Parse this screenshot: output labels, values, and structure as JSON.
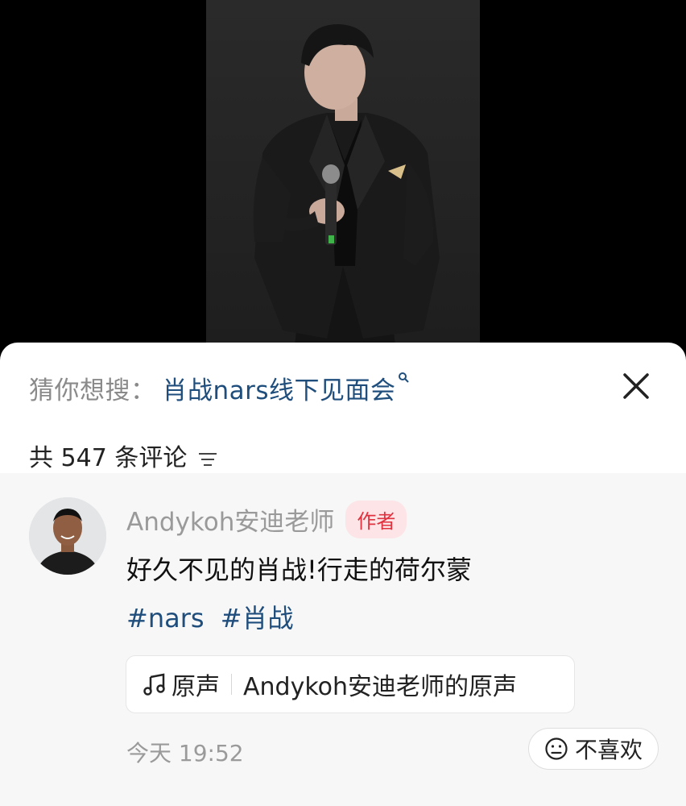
{
  "suggest": {
    "prefix": "猜你想搜：",
    "term": "肖战nars线下见面会",
    "search_icon": "search-icon"
  },
  "close": {
    "icon": "close-icon"
  },
  "comments_header": {
    "count_text": "共 547 条评论",
    "sort_icon": "sort-icon"
  },
  "comment": {
    "author": "Andykoh安迪老师",
    "badge": "作者",
    "text": "好久不见的肖战!行走的荷尔蒙",
    "hashtags": [
      "#nars",
      "#肖战"
    ],
    "sound": {
      "icon": "music-note-icon",
      "label": "原声",
      "name": "Andykoh安迪老师的原声"
    },
    "time": "今天 19:52",
    "dislike_label": "不喜欢"
  },
  "colors": {
    "link": "#1f4e7d",
    "badge_text": "#e0323f",
    "badge_bg": "#fde4e6"
  }
}
